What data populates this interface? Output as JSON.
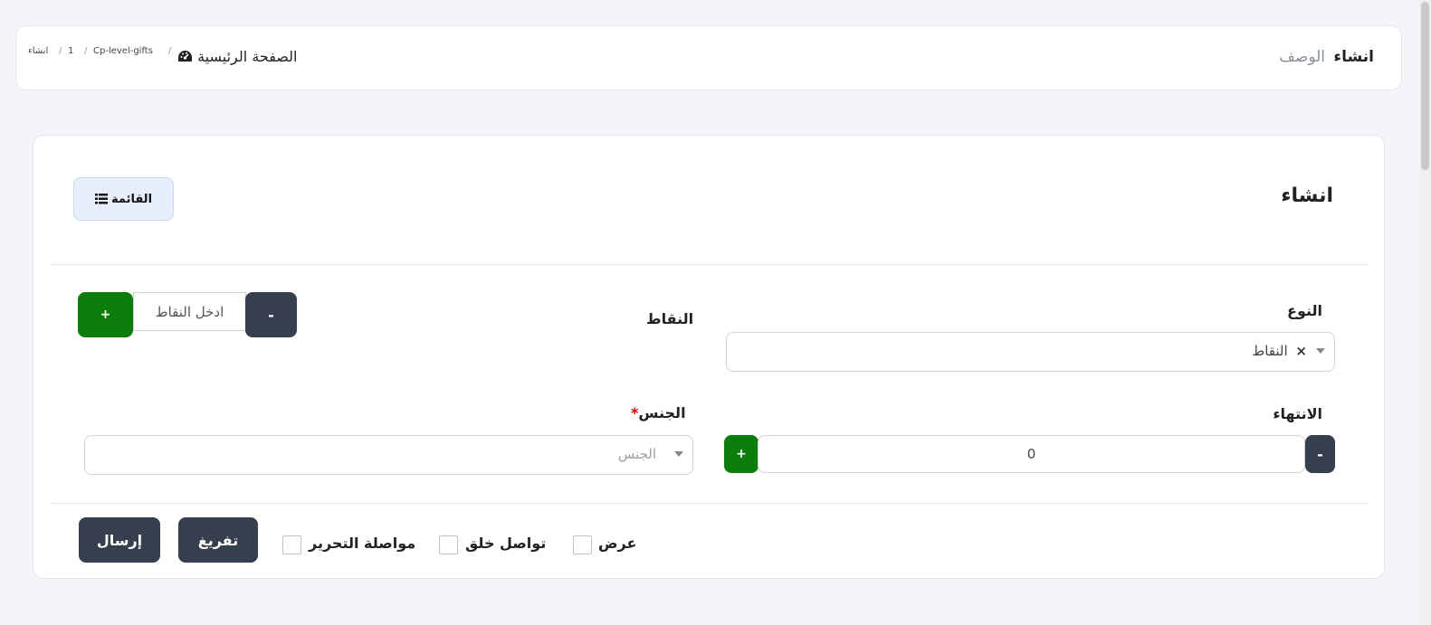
{
  "header": {
    "title_strong": "انشاء",
    "title_muted": "الوصف",
    "breadcrumb": {
      "home_icon": "dashboard-gauge-icon",
      "home": "الصفحة الرئيسية",
      "items": [
        "Cp-level-gifts",
        "1",
        "انشاء"
      ],
      "separator": "/"
    }
  },
  "card": {
    "title": "انشاء",
    "list_button": {
      "label": "القائمة",
      "icon": "list-icon"
    }
  },
  "form": {
    "type": {
      "label": "النوع",
      "selected_chip": "النقاط",
      "chip_remove": "×"
    },
    "points": {
      "label": "النقاط",
      "placeholder": "ادخل النقاط",
      "minus": "-",
      "plus": "+"
    },
    "end": {
      "label": "الانتهاء",
      "value": "0",
      "minus": "-",
      "plus": "+"
    },
    "gender": {
      "label": "الجنس",
      "required_mark": "*",
      "placeholder": "الجنس"
    }
  },
  "footer": {
    "checkboxes": [
      {
        "label": "عرض",
        "checked": false
      },
      {
        "label": "تواصل خلق",
        "checked": false
      },
      {
        "label": "مواصلة التحرير",
        "checked": false
      }
    ],
    "reset_label": "تفريغ",
    "submit_label": "إرسال"
  }
}
